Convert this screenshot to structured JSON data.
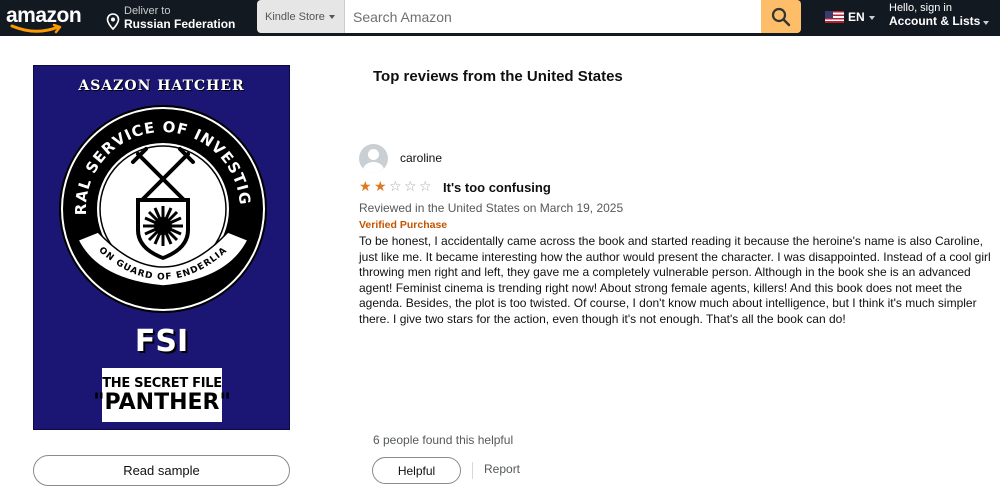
{
  "header": {
    "logo_text": "amazon",
    "deliver_line1": "Deliver to",
    "deliver_line2": "Russian Federation",
    "search_department": "Kindle Store",
    "search_placeholder": "Search Amazon",
    "language": "EN",
    "account_line1": "Hello, sign in",
    "account_line2": "Account & Lists",
    "colors": {
      "nav_bg": "#131921",
      "search_button": "#febd69"
    }
  },
  "book_cover": {
    "author": "ASAZON HATCHER",
    "seal_top_text": "FEDERAL SERVICE OF INVESTIGATION",
    "seal_bottom_text": "ON GUARD OF ENDERLIA",
    "acronym": "FSI",
    "file_line1": "THE SECRET FILE",
    "file_line2": "\"PANTHER\"",
    "colors": {
      "background": "#1b1674"
    }
  },
  "read_sample_label": "Read sample",
  "reviews": {
    "section_title": "Top reviews from the United States",
    "items": [
      {
        "reviewer": "caroline",
        "rating": 2,
        "max_rating": 5,
        "title": "It's too confusing",
        "meta": "Reviewed in the United States on March 19, 2025",
        "badge": "Verified Purchase",
        "body": "To be honest, I accidentally came across the book and started reading it because the heroine's name is also Caroline, just like me. It became interesting how the author would present the character. I was disappointed. Instead of a cool girl throwing men right and left, they gave me a completely vulnerable person. Although in the book she is an advanced agent! Feminist cinema is trending right now! About strong female agents, killers! And this book does not meet the agenda. Besides, the plot is too twisted. Of course, I don't know much about intelligence, but I think it's much simpler there. I give two stars for the action, even though it's not enough. That's all the book can do!",
        "helpful_count_text": "6 people found this helpful",
        "helpful_label": "Helpful",
        "report_label": "Report"
      }
    ]
  },
  "icons": [
    "location-pin-icon",
    "search-icon",
    "us-flag-icon",
    "caret-down-icon",
    "avatar-icon",
    "star-icon"
  ],
  "colors": {
    "star": "#de7921",
    "verified": "#c45500"
  }
}
